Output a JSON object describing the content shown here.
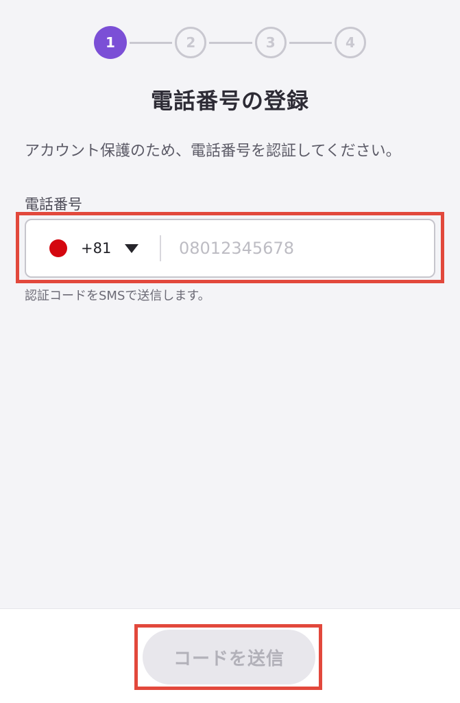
{
  "stepper": {
    "steps": [
      {
        "label": "1",
        "state": "active"
      },
      {
        "label": "2",
        "state": "inactive"
      },
      {
        "label": "3",
        "state": "inactive"
      },
      {
        "label": "4",
        "state": "inactive"
      }
    ],
    "current_step": 1,
    "active_color": "#7b4fd6",
    "inactive_color": "#c9c8d0"
  },
  "page_title": "電話番号の登録",
  "description": "アカウント保護のため、電話番号を認証してください。",
  "phone": {
    "label": "電話番号",
    "country_flag_icon": "japan-flag-icon",
    "flag_color": "#d4070f",
    "dial_code": "+81",
    "dropdown_icon": "caret-down-icon",
    "value": "",
    "placeholder": "08012345678",
    "helper_text": "認証コードをSMSで送信します。"
  },
  "actions": {
    "send_code_label": "コードを送信",
    "send_code_disabled": true
  },
  "highlight_color": "#e2483c"
}
